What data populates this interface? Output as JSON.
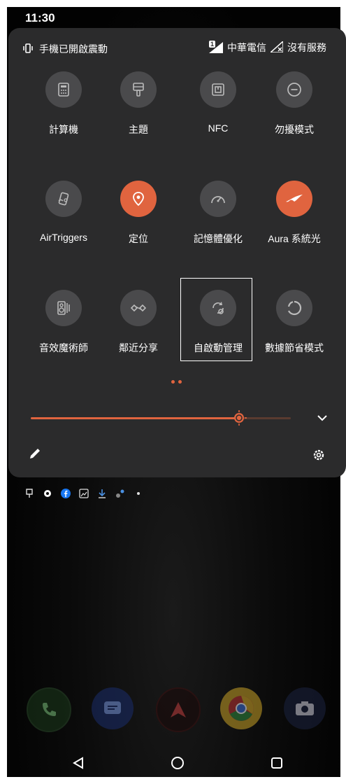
{
  "status": {
    "time": "11:30"
  },
  "panel": {
    "vibrate_text": "手機已開啟震動",
    "carrier": "中華電信",
    "service": "沒有服務",
    "sim_badge": "1"
  },
  "tiles": [
    {
      "label": "計算機",
      "icon": "calculator-icon",
      "active": false
    },
    {
      "label": "主題",
      "icon": "theme-brush-icon",
      "active": false
    },
    {
      "label": "NFC",
      "icon": "nfc-icon",
      "active": false
    },
    {
      "label": "勿擾模式",
      "icon": "do-not-disturb-icon",
      "active": false
    },
    {
      "label": "AirTriggers",
      "icon": "airtriggers-icon",
      "active": false
    },
    {
      "label": "定位",
      "icon": "location-icon",
      "active": true
    },
    {
      "label": "記憶體優化",
      "icon": "memory-boost-icon",
      "active": false
    },
    {
      "label": "Aura 系統光",
      "icon": "rog-aura-icon",
      "active": true
    },
    {
      "label": "音效魔術師",
      "icon": "audio-wizard-icon",
      "active": false
    },
    {
      "label": "鄰近分享",
      "icon": "nearby-share-icon",
      "active": false
    },
    {
      "label": "自啟動管理",
      "icon": "auto-start-manager-icon",
      "active": false
    },
    {
      "label": "數據節省模式",
      "icon": "data-saver-icon",
      "active": false
    }
  ],
  "brightness": {
    "level_percent": 80
  },
  "colors": {
    "accent": "#e0643f",
    "tile_off": "#4a4a4c",
    "panel": "#2b2b2c"
  }
}
